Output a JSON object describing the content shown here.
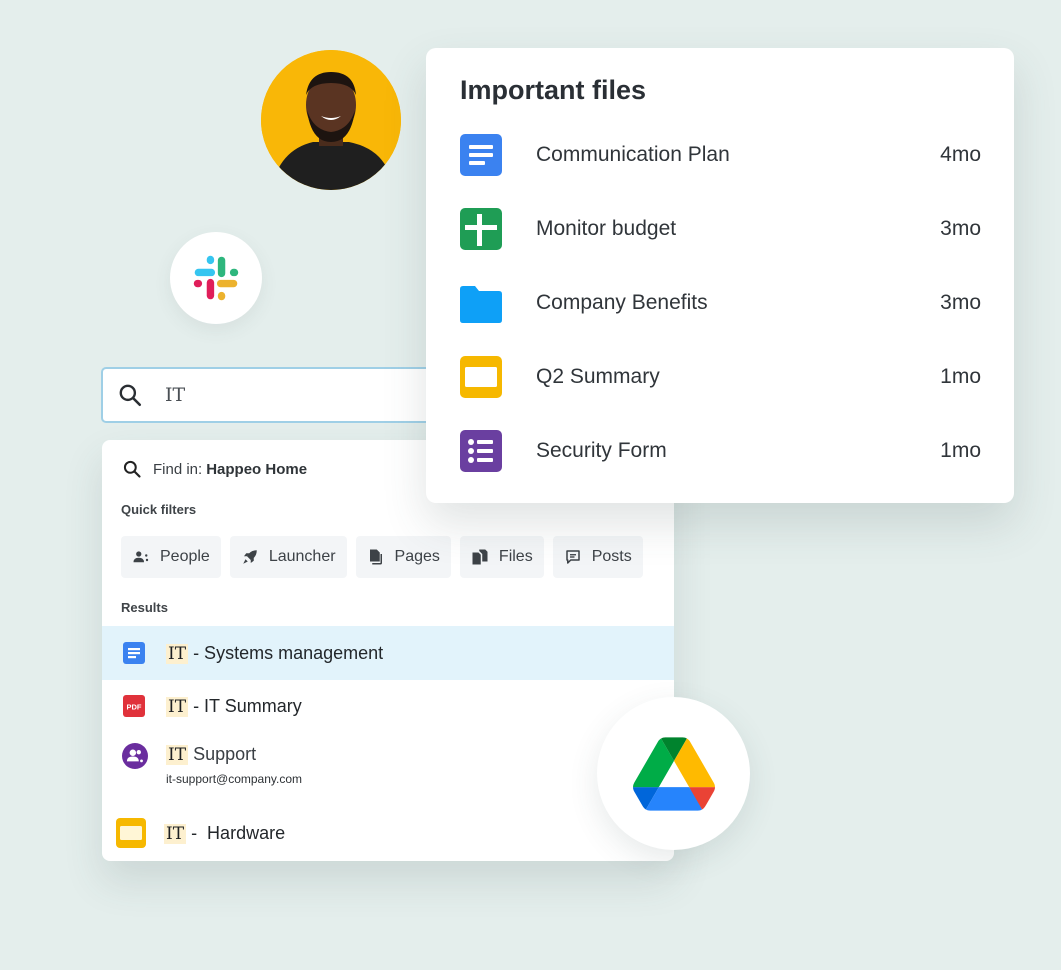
{
  "avatar": {
    "alt": "User avatar",
    "background_color": "#f9b707"
  },
  "integrations": [
    {
      "name": "Slack"
    },
    {
      "name": "Google Drive"
    }
  ],
  "search": {
    "value": "IT",
    "placeholder": "Search"
  },
  "dropdown": {
    "find_in_prefix": "Find in:",
    "find_in_target": "Happeo Home",
    "quick_filters_label": "Quick filters",
    "quick_filters": [
      {
        "label": "People",
        "icon": "people-icon"
      },
      {
        "label": "Launcher",
        "icon": "rocket-icon"
      },
      {
        "label": "Pages",
        "icon": "pages-icon"
      },
      {
        "label": "Files",
        "icon": "files-icon"
      },
      {
        "label": "Posts",
        "icon": "chat-icon"
      }
    ],
    "results_label": "Results",
    "results": [
      {
        "highlight": "IT",
        "rest": " - Systems management",
        "icon": "google-docs-icon",
        "active": true
      },
      {
        "highlight": "IT",
        "rest": " - IT Summary",
        "icon": "pdf-icon",
        "active": false
      },
      {
        "highlight": "IT",
        "rest": " Support",
        "subtitle": "it-support@company.com",
        "icon": "group-icon",
        "active": false
      },
      {
        "highlight": "IT",
        "rest": " -  Hardware",
        "icon": "google-slides-icon",
        "active": false
      }
    ]
  },
  "important_files": {
    "title": "Important files",
    "files": [
      {
        "name": "Communication Plan",
        "age": "4mo",
        "icon": "google-docs-icon",
        "color": "#3b82f0"
      },
      {
        "name": "Monitor budget",
        "age": "3mo",
        "icon": "google-sheets-icon",
        "color": "#1f9d55"
      },
      {
        "name": "Company Benefits",
        "age": "3mo",
        "icon": "folder-icon",
        "color": "#0ea0f7"
      },
      {
        "name": "Q2 Summary",
        "age": "1mo",
        "icon": "google-slides-icon",
        "color": "#f6b800"
      },
      {
        "name": "Security Form",
        "age": "1mo",
        "icon": "google-forms-icon",
        "color": "#6a3fa0"
      }
    ]
  },
  "colors": {
    "background": "#e4eeec",
    "active_result": "#e2f3fb",
    "highlight": "#fdf0cf",
    "search_border": "#9fcfe6"
  }
}
